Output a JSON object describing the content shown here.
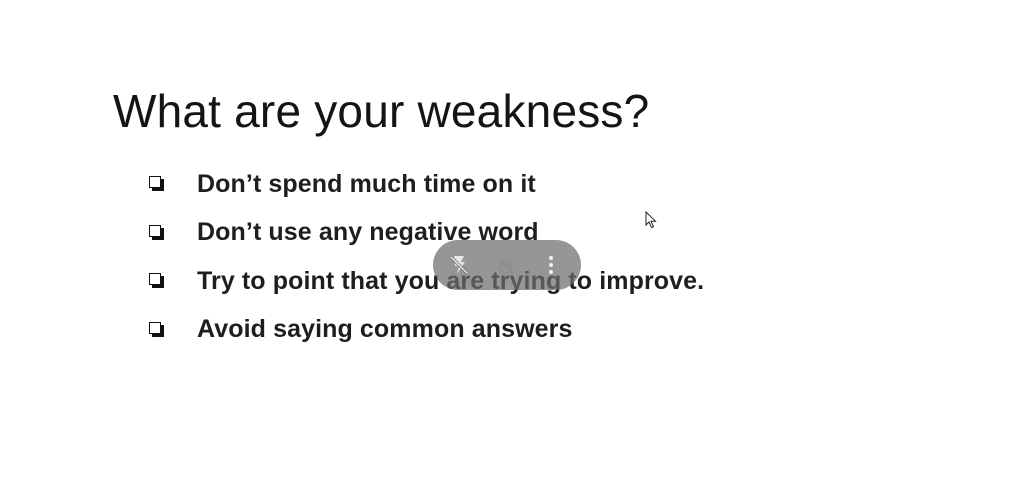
{
  "slide": {
    "title": "What are your weakness?",
    "bullets": [
      {
        "text": "Don’t spend much time on it",
        "icon": "checkbox-icon"
      },
      {
        "text": "Don’t use any negative word",
        "icon": "checkbox-icon"
      },
      {
        "text": "Try to point that you are trying to improve.",
        "icon": "checkbox-icon"
      },
      {
        "text": "Avoid saying common answers",
        "icon": "checkbox-icon"
      }
    ]
  },
  "overlay_toolbar": {
    "buttons": [
      {
        "icon": "no-flash-icon"
      },
      {
        "icon": "hand-off-icon"
      },
      {
        "icon": "more-vertical-icon"
      }
    ],
    "background": "#6e6e6e"
  },
  "cursor": {
    "icon": "mouse-pointer-icon"
  }
}
